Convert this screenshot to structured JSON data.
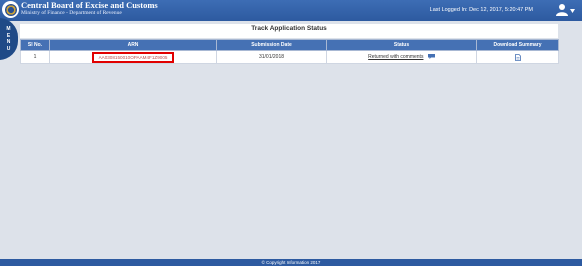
{
  "header": {
    "org_title": "Central Board of Excise and Customs",
    "org_subtitle": "Ministry of Finance - Department of Revenue",
    "last_logged": "Last Logged In: Dec 12, 2017, 5:20:47 PM"
  },
  "menu": {
    "letters": [
      "M",
      "E",
      "N",
      "U"
    ]
  },
  "panel": {
    "title": "Track Application Status",
    "columns": [
      "Sl No.",
      "ARN",
      "Submission Date",
      "Status",
      "Download Summary"
    ],
    "rows": [
      {
        "sl_no": "1",
        "arn": "AA0308150010OPAAM4F1Z9005",
        "submission_date": "31/01/2018",
        "status": "Returned with comments"
      }
    ]
  },
  "footer": {
    "text": "© Copyright Information 2017"
  },
  "colors": {
    "header_blue": "#2d5aa0",
    "table_header": "#4571b4",
    "highlight_red": "#e10000",
    "background": "#dde2ea"
  },
  "icons": [
    "logo-emblem",
    "user-icon",
    "caret-down-icon",
    "chat-icon",
    "document-icon"
  ]
}
